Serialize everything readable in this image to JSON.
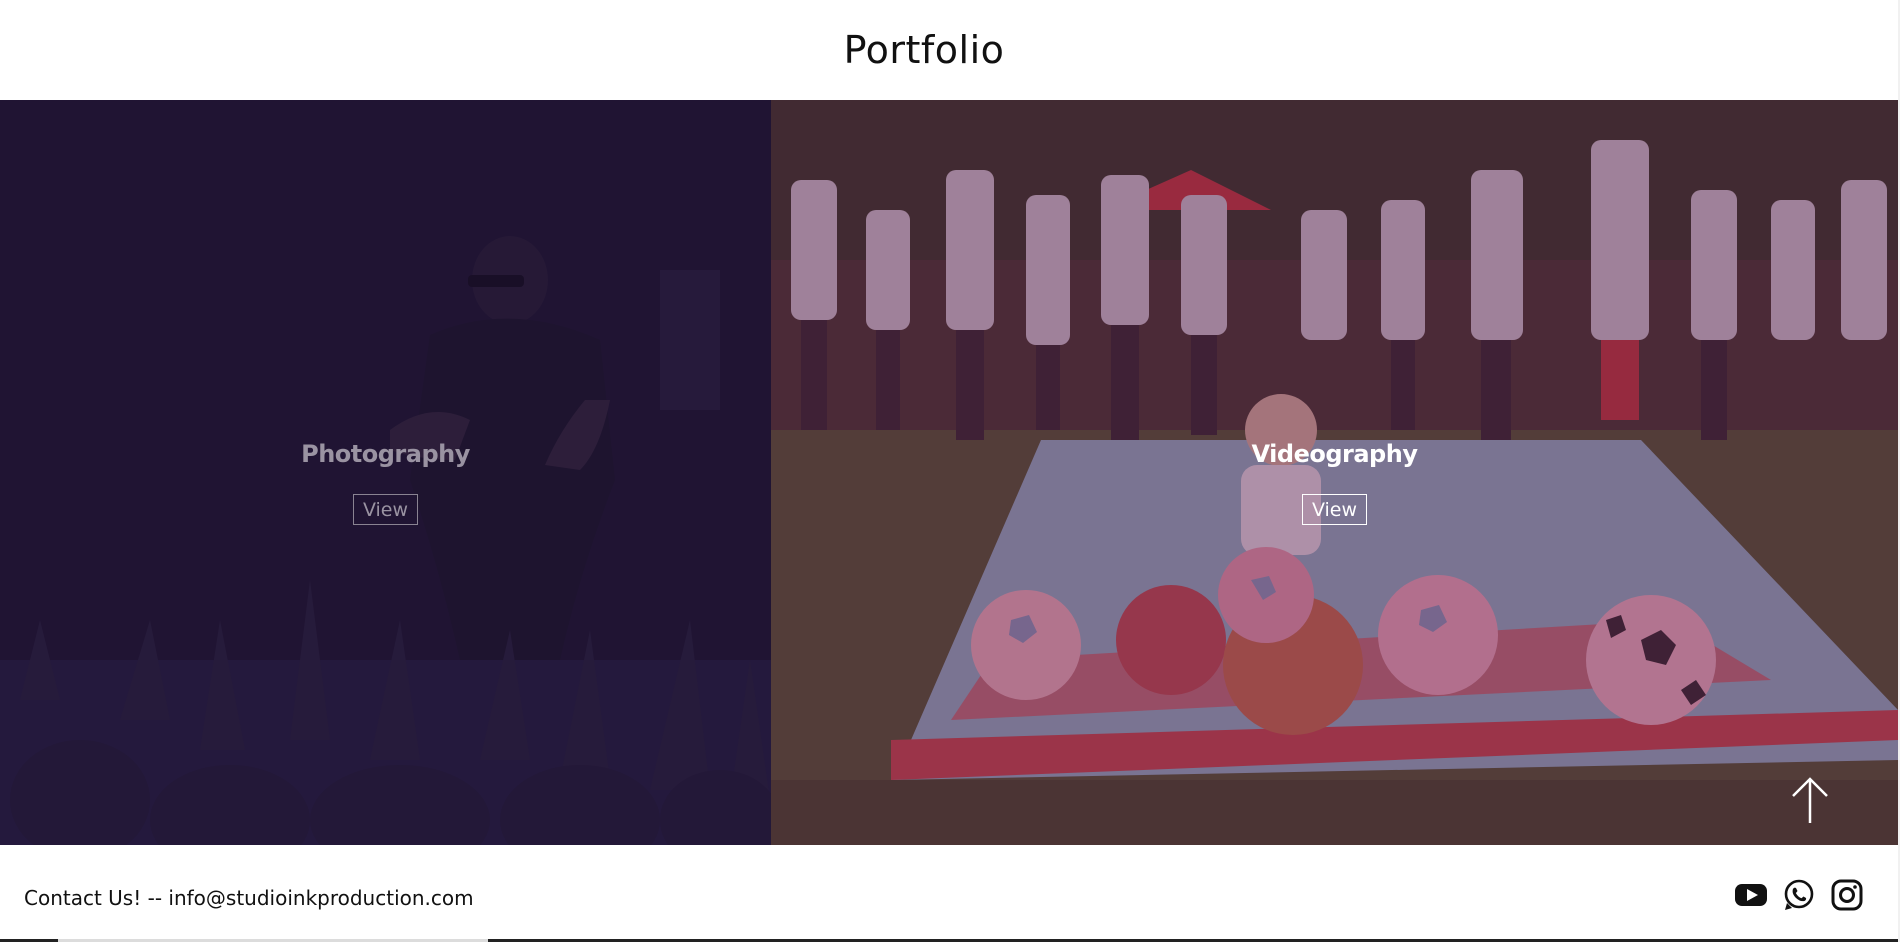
{
  "header": {
    "title": "Portfolio"
  },
  "portfolio": {
    "panels": [
      {
        "label": "Photography",
        "button_label": "View",
        "scene": "concert-performer-with-raised-hands"
      },
      {
        "label": "Videography",
        "button_label": "View",
        "scene": "child-with-soccer-balls-on-mat"
      }
    ],
    "back_to_top_icon": "arrow-up-icon"
  },
  "footer": {
    "contact_text": "Contact Us! -- info@studioinkproduction.com",
    "social_icons": [
      "youtube-icon",
      "whatsapp-icon",
      "instagram-icon"
    ]
  },
  "colors": {
    "photo_overlay": "#221436",
    "video_overlay": "#5c1648",
    "text_dark": "#111111",
    "muted_label": "#9a93a2"
  }
}
